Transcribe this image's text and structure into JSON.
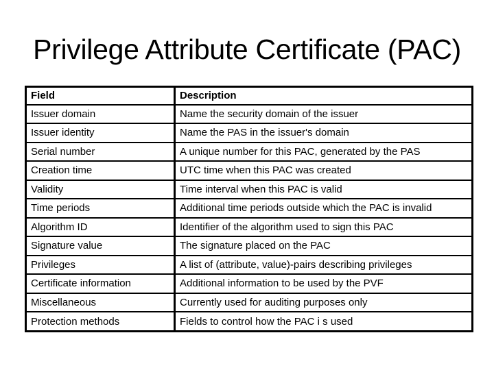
{
  "title": "Privilege Attribute Certificate (PAC)",
  "table": {
    "headers": [
      "Field",
      "Description"
    ],
    "rows": [
      [
        "Issuer domain",
        "Name the security domain of the issuer"
      ],
      [
        "Issuer identity",
        "Name the PAS in the issuer's domain"
      ],
      [
        "Serial number",
        "A unique number for this PAC, generated by the PAS"
      ],
      [
        "Creation time",
        "UTC time when this PAC was created"
      ],
      [
        "Validity",
        "Time interval when this PAC is valid"
      ],
      [
        "Time periods",
        "Additional time periods outside which the PAC is invalid"
      ],
      [
        "Algorithm ID",
        "Identifier of the algorithm used to sign this PAC"
      ],
      [
        "Signature value",
        "The signature placed on the PAC"
      ],
      [
        "Privileges",
        "A list of (attribute, value)-pairs describing privileges"
      ],
      [
        "Certificate information",
        "Additional information to be used by the PVF"
      ],
      [
        "Miscellaneous",
        "Currently used for auditing purposes only"
      ],
      [
        "Protection methods",
        "Fields to control how the PAC i s used"
      ]
    ]
  }
}
